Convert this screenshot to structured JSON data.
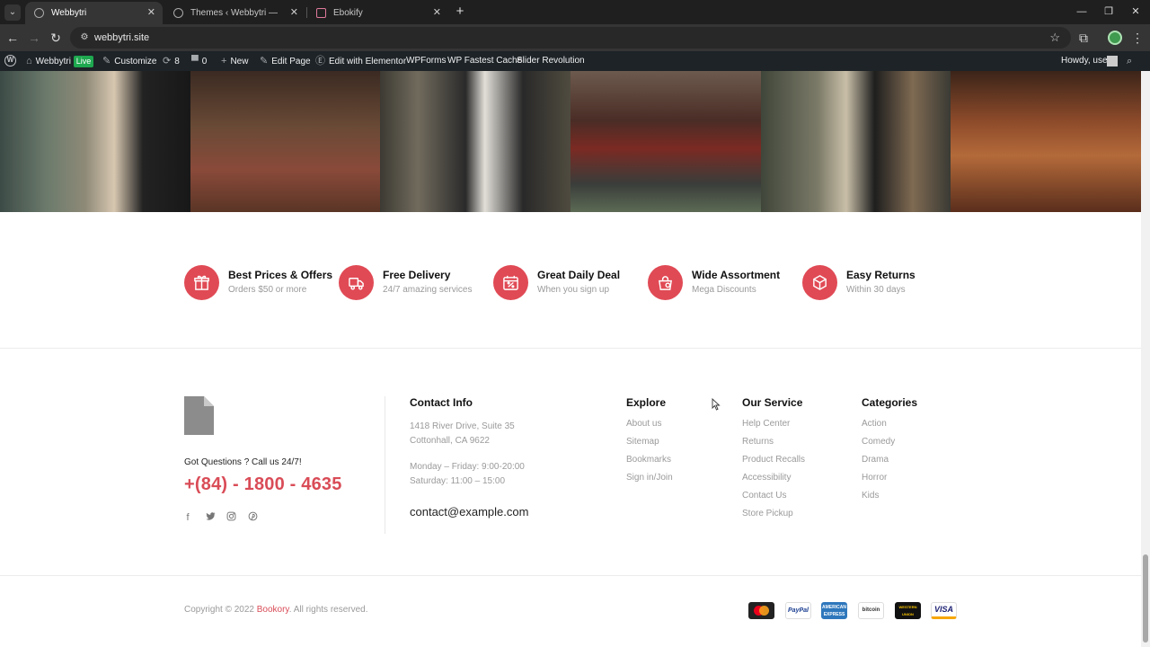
{
  "browser": {
    "tabs": [
      {
        "title": "Webbytri",
        "active": true
      },
      {
        "title": "Themes ‹ Webbytri — WordPre",
        "active": false
      },
      {
        "title": "Ebokify",
        "active": false
      }
    ],
    "url": "webbytri.site"
  },
  "wp_admin_bar": {
    "site": "Webbytri",
    "live": "Live",
    "customize": "Customize",
    "updates": "8",
    "comments": "0",
    "new": "New",
    "edit_page": "Edit Page",
    "elementor": "Edit with Elementor",
    "wpforms": "WPForms",
    "cache": "WP Fastest Cache",
    "slider": "Slider Revolution",
    "howdy": "Howdy, user"
  },
  "features": [
    {
      "title": "Best Prices & Offers",
      "subtitle": "Orders $50 or more",
      "icon": "gift-icon"
    },
    {
      "title": "Free Delivery",
      "subtitle": "24/7 amazing services",
      "icon": "delivery-truck-icon"
    },
    {
      "title": "Great Daily Deal",
      "subtitle": "When you sign up",
      "icon": "calendar-discount-icon"
    },
    {
      "title": "Wide Assortment",
      "subtitle": "Mega Discounts",
      "icon": "shopping-bag-icon"
    },
    {
      "title": "Easy Returns",
      "subtitle": "Within 30 days",
      "icon": "return-box-icon"
    }
  ],
  "footer": {
    "questions": "Got Questions ? Call us 24/7!",
    "phone": "+(84) - 1800 - 4635",
    "contact": {
      "title": "Contact Info",
      "address_line1": "1418 River Drive, Suite 35",
      "address_line2": "Cottonhall, CA 9622",
      "hours_line1": "Monday – Friday: 9:00-20:00",
      "hours_line2": "Saturday: 11:00 – 15:00",
      "email": "contact@example.com"
    },
    "explore": {
      "title": "Explore",
      "links": [
        "About us",
        "Sitemap",
        "Bookmarks",
        "Sign in/Join"
      ]
    },
    "service": {
      "title": "Our Service",
      "links": [
        "Help Center",
        "Returns",
        "Product Recalls",
        "Accessibility",
        "Contact Us",
        "Store Pickup"
      ]
    },
    "categories": {
      "title": "Categories",
      "links": [
        "Action",
        "Comedy",
        "Drama",
        "Horror",
        "Kids"
      ]
    },
    "copyright_prefix": "Copyright © 2022 ",
    "copyright_brand": "Bookory",
    "copyright_suffix": ". All rights reserved.",
    "payments": [
      "MasterCard",
      "PayPal",
      "AMERICAN EXPRESS",
      "bitcoin",
      "WESTERN UNION",
      "VISA"
    ]
  }
}
